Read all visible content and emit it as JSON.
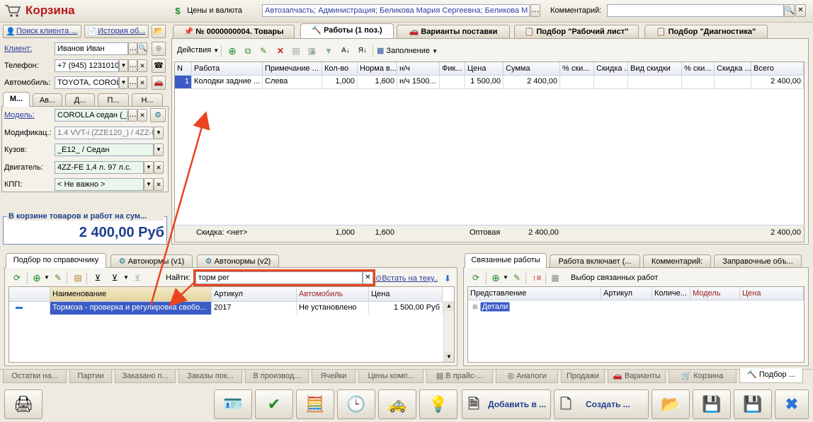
{
  "title": "Корзина",
  "top": {
    "prices_label": "Цены и валюта",
    "org_value": "Автозапчасть; Администрация; Беликова Мария Сергеевна; Беликова М",
    "comment_label": "Комментарий:",
    "comment_value": ""
  },
  "client": {
    "search_link": "Поиск клиента ...",
    "history_link": "История об...",
    "client_label": "Клиент:",
    "client_value": "Иванов Иван",
    "phone_label": "Телефон:",
    "phone_value": "+7 (945) 1231010",
    "car_label": "Автомобиль:",
    "car_value": "TOYOTA, COROL"
  },
  "car_tabs": [
    "М...",
    "Ав...",
    "Д...",
    "П...",
    "Н..."
  ],
  "car": {
    "model_label": "Модель:",
    "model_value": "COROLLA седан (_E",
    "mod_label": "Модификац.:",
    "mod_value": "1.4 VVT-i (ZZE120_) / 4ZZ-F",
    "body_label": "Кузов:",
    "body_value": "_E12_ / Седан",
    "engine_label": "Двигатель:",
    "engine_value": "4ZZ-FE 1,4 л. 97 л.с.",
    "kpp_label": "КПП:",
    "kpp_value": "< Не важно >"
  },
  "sum": {
    "caption": "В корзине товаров и работ на сум...",
    "value": "2 400,00 Руб"
  },
  "main_tabs": [
    "№ 0000000004. Товары",
    "Работы (1 поз.)",
    "Варианты поставки",
    "Подбор \"Рабочий лист\"",
    "Подбор \"Диагностика\""
  ],
  "toolbar": {
    "actions": "Действия",
    "fill": "Заполнение"
  },
  "works_table": {
    "headers": [
      "N",
      "Работа",
      "Примечание ...",
      "Кол-во",
      "Норма в...",
      "н/ч",
      "Фик...",
      "Цена",
      "Сумма",
      "% ски...",
      "Скидка ...",
      "Вид скидки",
      "% ски...",
      "Скидка ...",
      "Всего"
    ],
    "row": [
      "1",
      "Колодки задние ...",
      "Слева",
      "1,000",
      "1,600",
      "н/ч 1500...",
      "",
      "1 500,00",
      "2 400,00",
      "",
      "",
      "",
      "",
      "",
      "2 400,00"
    ],
    "footer": {
      "discount": "Скидка: <нет>",
      "qty": "1,000",
      "norm": "1,600",
      "price_type": "Оптовая",
      "sum": "2 400,00",
      "total": "2 400,00"
    }
  },
  "lower_left_tabs": [
    "Подбор по справочнику",
    "Автонормы (v1)",
    "Автонормы (v2)"
  ],
  "search": {
    "label": "Найти:",
    "value": "торм рег",
    "insert_link": "Встать на теку..."
  },
  "catalog_table": {
    "headers": [
      "Наименование",
      "Артикул",
      "Автомобиль",
      "Цена"
    ],
    "row": [
      "Тормоза - проверка и регулировка свобо...",
      "2017",
      "Не установлено",
      "1 500,00 Руб"
    ]
  },
  "lower_right_tabs": [
    "Связанные работы",
    "Работа включает (...",
    "Комментарий:",
    "Заправочные объ..."
  ],
  "related": {
    "select_label": "Выбор связанных работ",
    "headers": [
      "Представление",
      "Артикул",
      "Количе...",
      "Модель",
      "Цена"
    ],
    "tree_item": "Детали"
  },
  "bottom_tabs": [
    "Остатки на...",
    "Партии",
    "Заказано п...",
    "Заказы пок...",
    "В производ...",
    "Ячейки",
    "Цены комп...",
    "В прайс-...",
    "Аналоги",
    "Продажи",
    "Варианты",
    "Корзина",
    "Подбор ..."
  ],
  "bottom_buttons": {
    "add": "Добавить в ...",
    "create": "Создать ..."
  },
  "colors": {
    "title": "#b8161a",
    "selection": "#3b5cc6",
    "highlight_border": "#e8451f",
    "arrow": "#e8451f",
    "sum_text": "#1f3f8f"
  }
}
